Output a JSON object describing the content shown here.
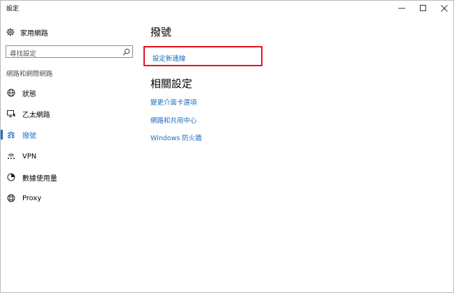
{
  "window": {
    "title": "設定"
  },
  "sidebar": {
    "home_label": "家用網路",
    "search_placeholder": "尋找設定",
    "section_label": "網路和網際網路",
    "items": [
      {
        "label": "狀態",
        "icon": "globe-icon"
      },
      {
        "label": "乙太網路",
        "icon": "ethernet-icon"
      },
      {
        "label": "撥號",
        "icon": "dialup-icon"
      },
      {
        "label": "VPN",
        "icon": "vpn-icon"
      },
      {
        "label": "數據使用量",
        "icon": "data-usage-icon"
      },
      {
        "label": "Proxy",
        "icon": "proxy-icon"
      }
    ],
    "active_index": 2
  },
  "main": {
    "title": "撥號",
    "setup_link": "設定新連線",
    "related_title": "相關設定",
    "related_links": [
      "變更介面卡選項",
      "網路和共用中心",
      "Windows 防火牆"
    ]
  },
  "colors": {
    "accent": "#1d6fbf",
    "highlight_border": "#e81123"
  }
}
